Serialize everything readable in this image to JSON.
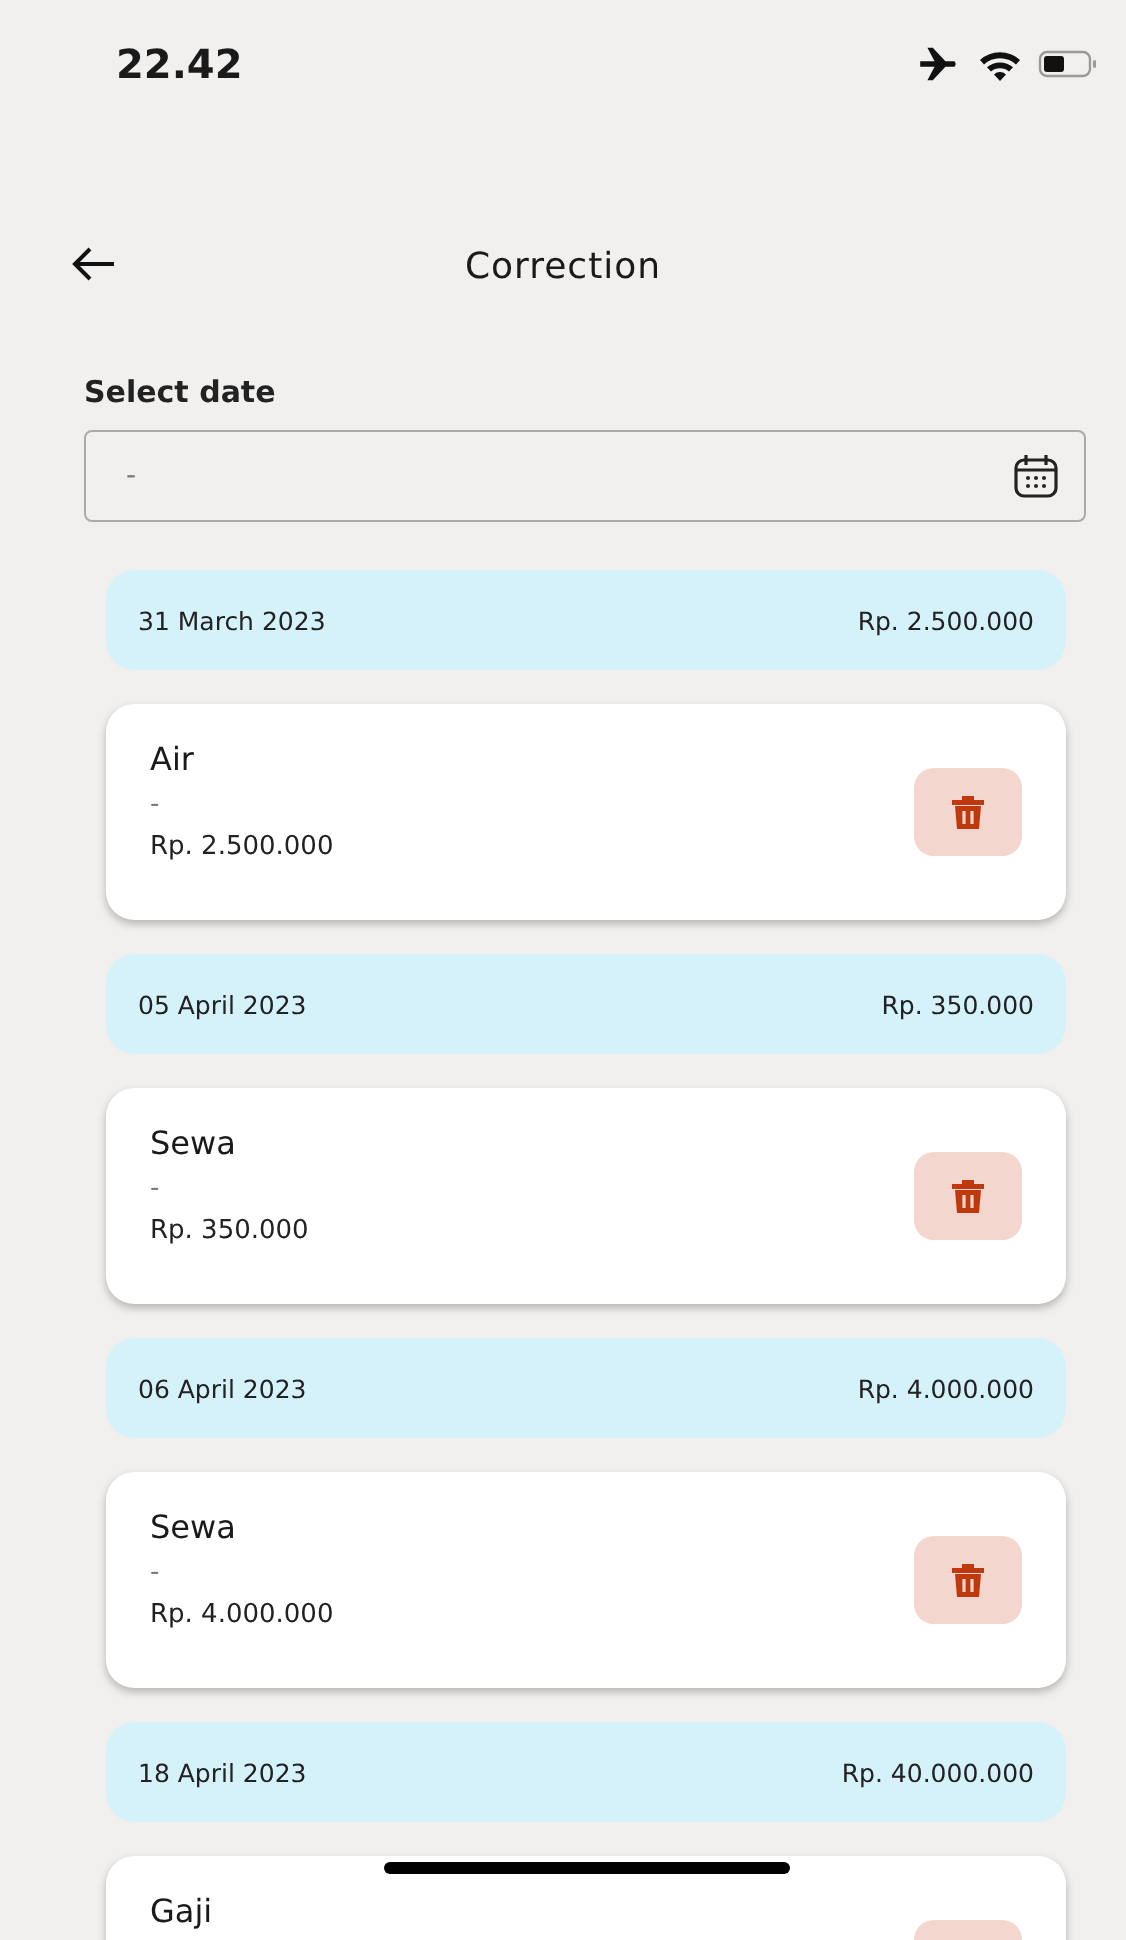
{
  "status_bar": {
    "time": "22.42"
  },
  "header": {
    "title": "Correction"
  },
  "date_filter": {
    "label": "Select date",
    "value": "-"
  },
  "groups": [
    {
      "date": "31 March 2023",
      "total": "Rp. 2.500.000",
      "items": [
        {
          "name": "Air",
          "note": "-",
          "amount": "Rp. 2.500.000"
        }
      ]
    },
    {
      "date": "05 April 2023",
      "total": "Rp. 350.000",
      "items": [
        {
          "name": "Sewa",
          "note": "-",
          "amount": "Rp. 350.000"
        }
      ]
    },
    {
      "date": "06 April 2023",
      "total": "Rp. 4.000.000",
      "items": [
        {
          "name": "Sewa",
          "note": "-",
          "amount": "Rp. 4.000.000"
        }
      ]
    },
    {
      "date": "18 April 2023",
      "total": "Rp. 40.000.000",
      "items": [
        {
          "name": "Gaji"
        }
      ]
    }
  ]
}
